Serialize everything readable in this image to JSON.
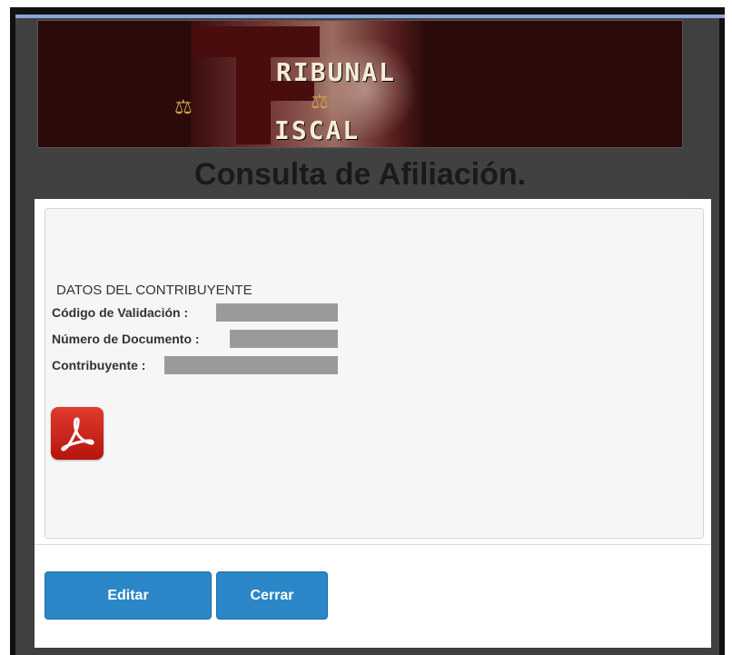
{
  "banner": {
    "word1": "RIBUNAL",
    "word2": "ISCAL"
  },
  "page_title": "Consulta de Afiliación.",
  "section": {
    "title": "DATOS DEL CONTRIBUYENTE",
    "fields": [
      {
        "label": "Código de Validación :"
      },
      {
        "label": "Número de Documento :"
      },
      {
        "label": "Contribuyente :"
      }
    ]
  },
  "icons": {
    "pdf": "pdf-icon",
    "scale": "scales-of-justice-icon"
  },
  "buttons": {
    "edit": "Editar",
    "close": "Cerrar"
  },
  "colors": {
    "banner_bg": "#2b0a0a",
    "button_bg": "#2b87c7",
    "pdf_red": "#d0251b",
    "redaction": "#9a9a9a"
  }
}
